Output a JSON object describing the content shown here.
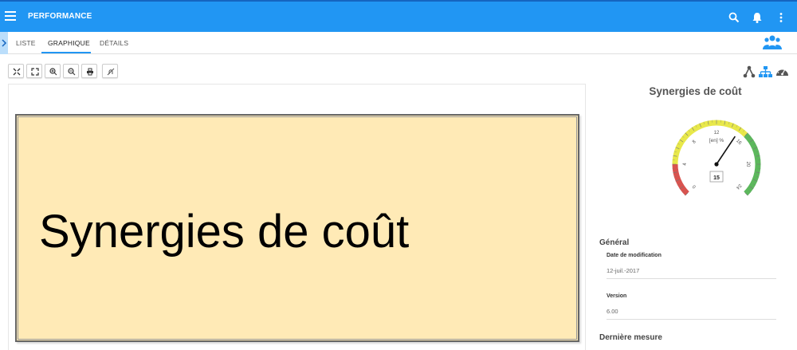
{
  "appbar": {
    "title": "PERFORMANCE",
    "color": "#2196f3",
    "icons": [
      "menu-icon",
      "search-icon",
      "bell-icon",
      "more-vert-icon"
    ]
  },
  "tabs": [
    {
      "label": "LISTE",
      "active": false
    },
    {
      "label": "GRAPHIQUE",
      "active": true
    },
    {
      "label": "DÉTAILS",
      "active": false
    }
  ],
  "toolbar": {
    "buttons": [
      "fit-icon",
      "fullscreen-icon",
      "zoom-in-icon",
      "zoom-out-icon",
      "print-icon",
      "hide-icon"
    ]
  },
  "canvas": {
    "note_text": "Synergies de coût",
    "note_color": "#ffeab6"
  },
  "view_icons": [
    "hierarchy-icon",
    "org-chart-icon",
    "dashboard-gauge-icon"
  ],
  "panel": {
    "title": "Synergies de coût",
    "gauge": {
      "min": 0,
      "max": 24,
      "ticks": [
        "0",
        "4",
        "8",
        "12",
        "16",
        "20",
        "24"
      ],
      "unit_label": "[en] %",
      "value": 15,
      "value_label": "15",
      "zones": [
        {
          "from": 0,
          "to": 4,
          "color": "#d9534f"
        },
        {
          "from": 4,
          "to": 16,
          "color": "#e8e84a"
        },
        {
          "from": 16,
          "to": 24,
          "color": "#5cb85c"
        }
      ]
    },
    "general": {
      "title": "Général",
      "date_label": "Date de modification",
      "date_value": "12-juil.-2017",
      "version_label": "Version",
      "version_value": "6.00"
    },
    "last_measure": {
      "title": "Dernière mesure"
    }
  }
}
